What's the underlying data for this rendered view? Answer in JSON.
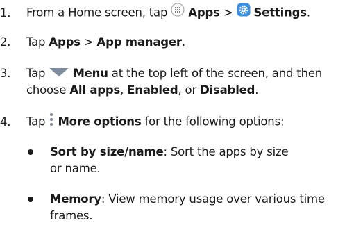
{
  "steps": [
    {
      "number": "1.",
      "line1": {
        "pre": "From a Home screen, tap",
        "apps": "Apps",
        "sep": ">",
        "settings": "Settings",
        "post": "."
      }
    },
    {
      "number": "2.",
      "line1": {
        "pre": "Tap",
        "apps": "Apps",
        "sep": ">",
        "manager": "App manager",
        "post": "."
      }
    },
    {
      "number": "3.",
      "line1": {
        "pre": "Tap",
        "menu": "Menu",
        "post": "at the top left of the screen, and then"
      },
      "line2": {
        "pre": "choose",
        "all": "All apps",
        "comma1": ",",
        "enabled": "Enabled",
        "or": ", or",
        "disabled": "Disabled",
        "post": "."
      }
    },
    {
      "number": "4.",
      "line1": {
        "pre": "Tap",
        "more": "More options",
        "post": "for the following options:"
      }
    }
  ],
  "bullets": [
    {
      "term": "Sort by size/name",
      "line1_rest": ": Sort the apps by size",
      "line2": "or name."
    },
    {
      "term": "Memory",
      "line1_rest": ": View memory usage over various time",
      "line2": "frames."
    }
  ],
  "icons": {
    "apps": "apps-grid-icon",
    "settings": "settings-gear-icon",
    "menu": "menu-triangle-icon",
    "more": "more-options-icon",
    "settings_color": "#3d8fe0",
    "menu_color": "#7f8c9e"
  }
}
